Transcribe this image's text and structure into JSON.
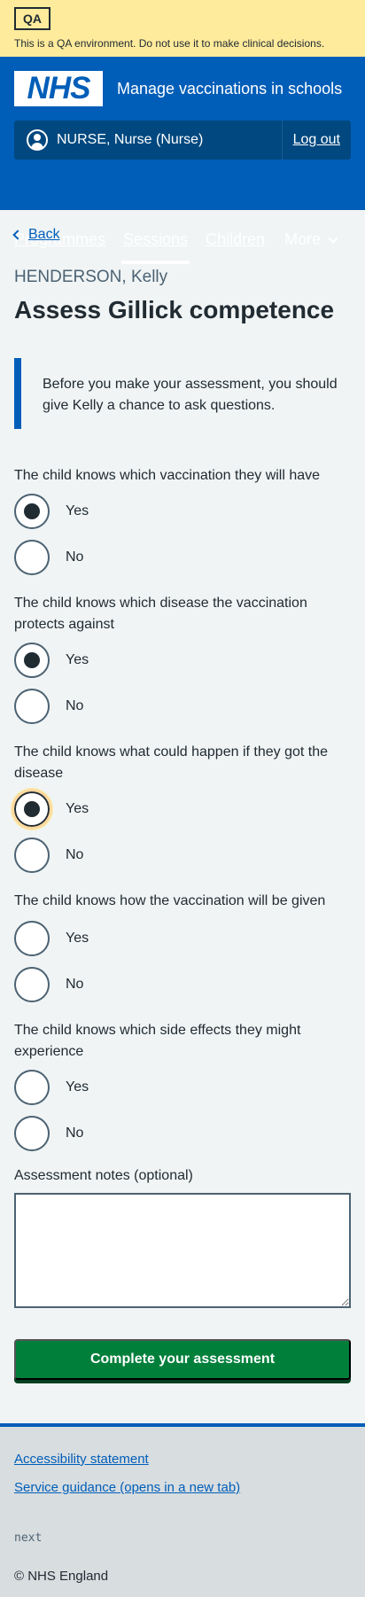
{
  "qa": {
    "tag": "QA",
    "text": "This is a QA environment. Do not use it to make clinical decisions."
  },
  "header": {
    "logo": "NHS",
    "service_name": "Manage vaccinations in schools",
    "account_name": "NURSE, Nurse (Nurse)",
    "logout": "Log out",
    "nav": [
      "Programmes",
      "Sessions",
      "Children"
    ],
    "more": "More"
  },
  "back": "Back",
  "caption": "HENDERSON, Kelly",
  "title": "Assess Gillick competence",
  "inset": "Before you make your assessment, you should give Kelly a chance to ask questions.",
  "questions": [
    {
      "text": "The child knows which vaccination they will have",
      "yes": "Yes",
      "no": "No",
      "selected": "Yes"
    },
    {
      "text": "The child knows which disease the vaccination protects against",
      "yes": "Yes",
      "no": "No",
      "selected": "Yes"
    },
    {
      "text": "The child knows what could happen if they got the disease",
      "yes": "Yes",
      "no": "No",
      "selected": "Yes"
    },
    {
      "text": "The child knows how the vaccination will be given",
      "yes": "Yes",
      "no": "No",
      "selected": ""
    },
    {
      "text": "The child knows which side effects they might experience",
      "yes": "Yes",
      "no": "No",
      "selected": ""
    }
  ],
  "notes_label": "Assessment notes (optional)",
  "submit": "Complete your assessment",
  "footer": {
    "accessibility": "Accessibility statement",
    "guidance": "Service guidance (opens in a new tab)",
    "version": "next",
    "copyright": "© NHS England"
  },
  "colors": {
    "nhs_blue": "#005eb8",
    "qa_yellow": "#ffeb9c",
    "green": "#007f3b"
  }
}
